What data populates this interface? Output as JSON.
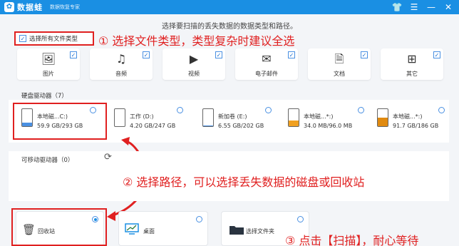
{
  "app": {
    "name": "数据蛙",
    "subtitle": "数据恢复专家",
    "title_icons": [
      "shirt-icon",
      "menu-icon",
      "minimize-icon",
      "close-icon"
    ]
  },
  "instruction": "选择要扫描的丢失数据的数据类型和路径。",
  "select_all": {
    "label": "选择所有文件类型",
    "checked": true
  },
  "annotations": {
    "step1": "① 选择文件类型，类型复杂时建议全选",
    "step2": "② 选择路径，可以选择丢失数据的磁盘或回收站",
    "step3": "③ 点击【扫描】，耐心等待"
  },
  "file_types": [
    {
      "label": "图片",
      "icon": "image-icon",
      "glyph": "🖼",
      "checked": true
    },
    {
      "label": "音频",
      "icon": "music-icon",
      "glyph": "♫",
      "checked": true
    },
    {
      "label": "视频",
      "icon": "video-icon",
      "glyph": "▶",
      "checked": true
    },
    {
      "label": "电子邮件",
      "icon": "mail-icon",
      "glyph": "✉",
      "checked": true
    },
    {
      "label": "文档",
      "icon": "document-icon",
      "glyph": "🗎",
      "checked": true
    },
    {
      "label": "其它",
      "icon": "other-icon",
      "glyph": "⊞",
      "checked": true
    }
  ],
  "hard_disk": {
    "title": "硬盘驱动器（7）",
    "drives": [
      {
        "name": "本地磁...C:)",
        "size": "59.9 GB/293 GB",
        "fill_color": "#4a90e2",
        "fill_fraction": 0.2,
        "selected": false
      },
      {
        "name": "工作 (D:)",
        "size": "4.20 GB/247 GB",
        "fill_color": "#4a90e2",
        "fill_fraction": 0.02,
        "selected": false
      },
      {
        "name": "新加卷 (E:)",
        "size": "6.55 GB/202 GB",
        "fill_color": "#4a90e2",
        "fill_fraction": 0.03,
        "selected": false
      },
      {
        "name": "本地磁...*:)",
        "size": "34.0 MB/96.0 MB",
        "fill_color": "#f0a020",
        "fill_fraction": 0.35,
        "selected": false
      },
      {
        "name": "本地磁...*:)",
        "size": "91.7 GB/186 GB",
        "fill_color": "#e08a10",
        "fill_fraction": 0.49,
        "selected": false
      }
    ]
  },
  "removable": {
    "title": "可移动驱动器（0）",
    "refresh_icon": "refresh-icon"
  },
  "paths": [
    {
      "label": "回收站",
      "icon": "trash-icon",
      "selected": true
    },
    {
      "label": "桌面",
      "icon": "desktop-icon",
      "selected": false
    },
    {
      "label": "选择文件夹",
      "icon": "folder-icon",
      "selected": false
    }
  ]
}
